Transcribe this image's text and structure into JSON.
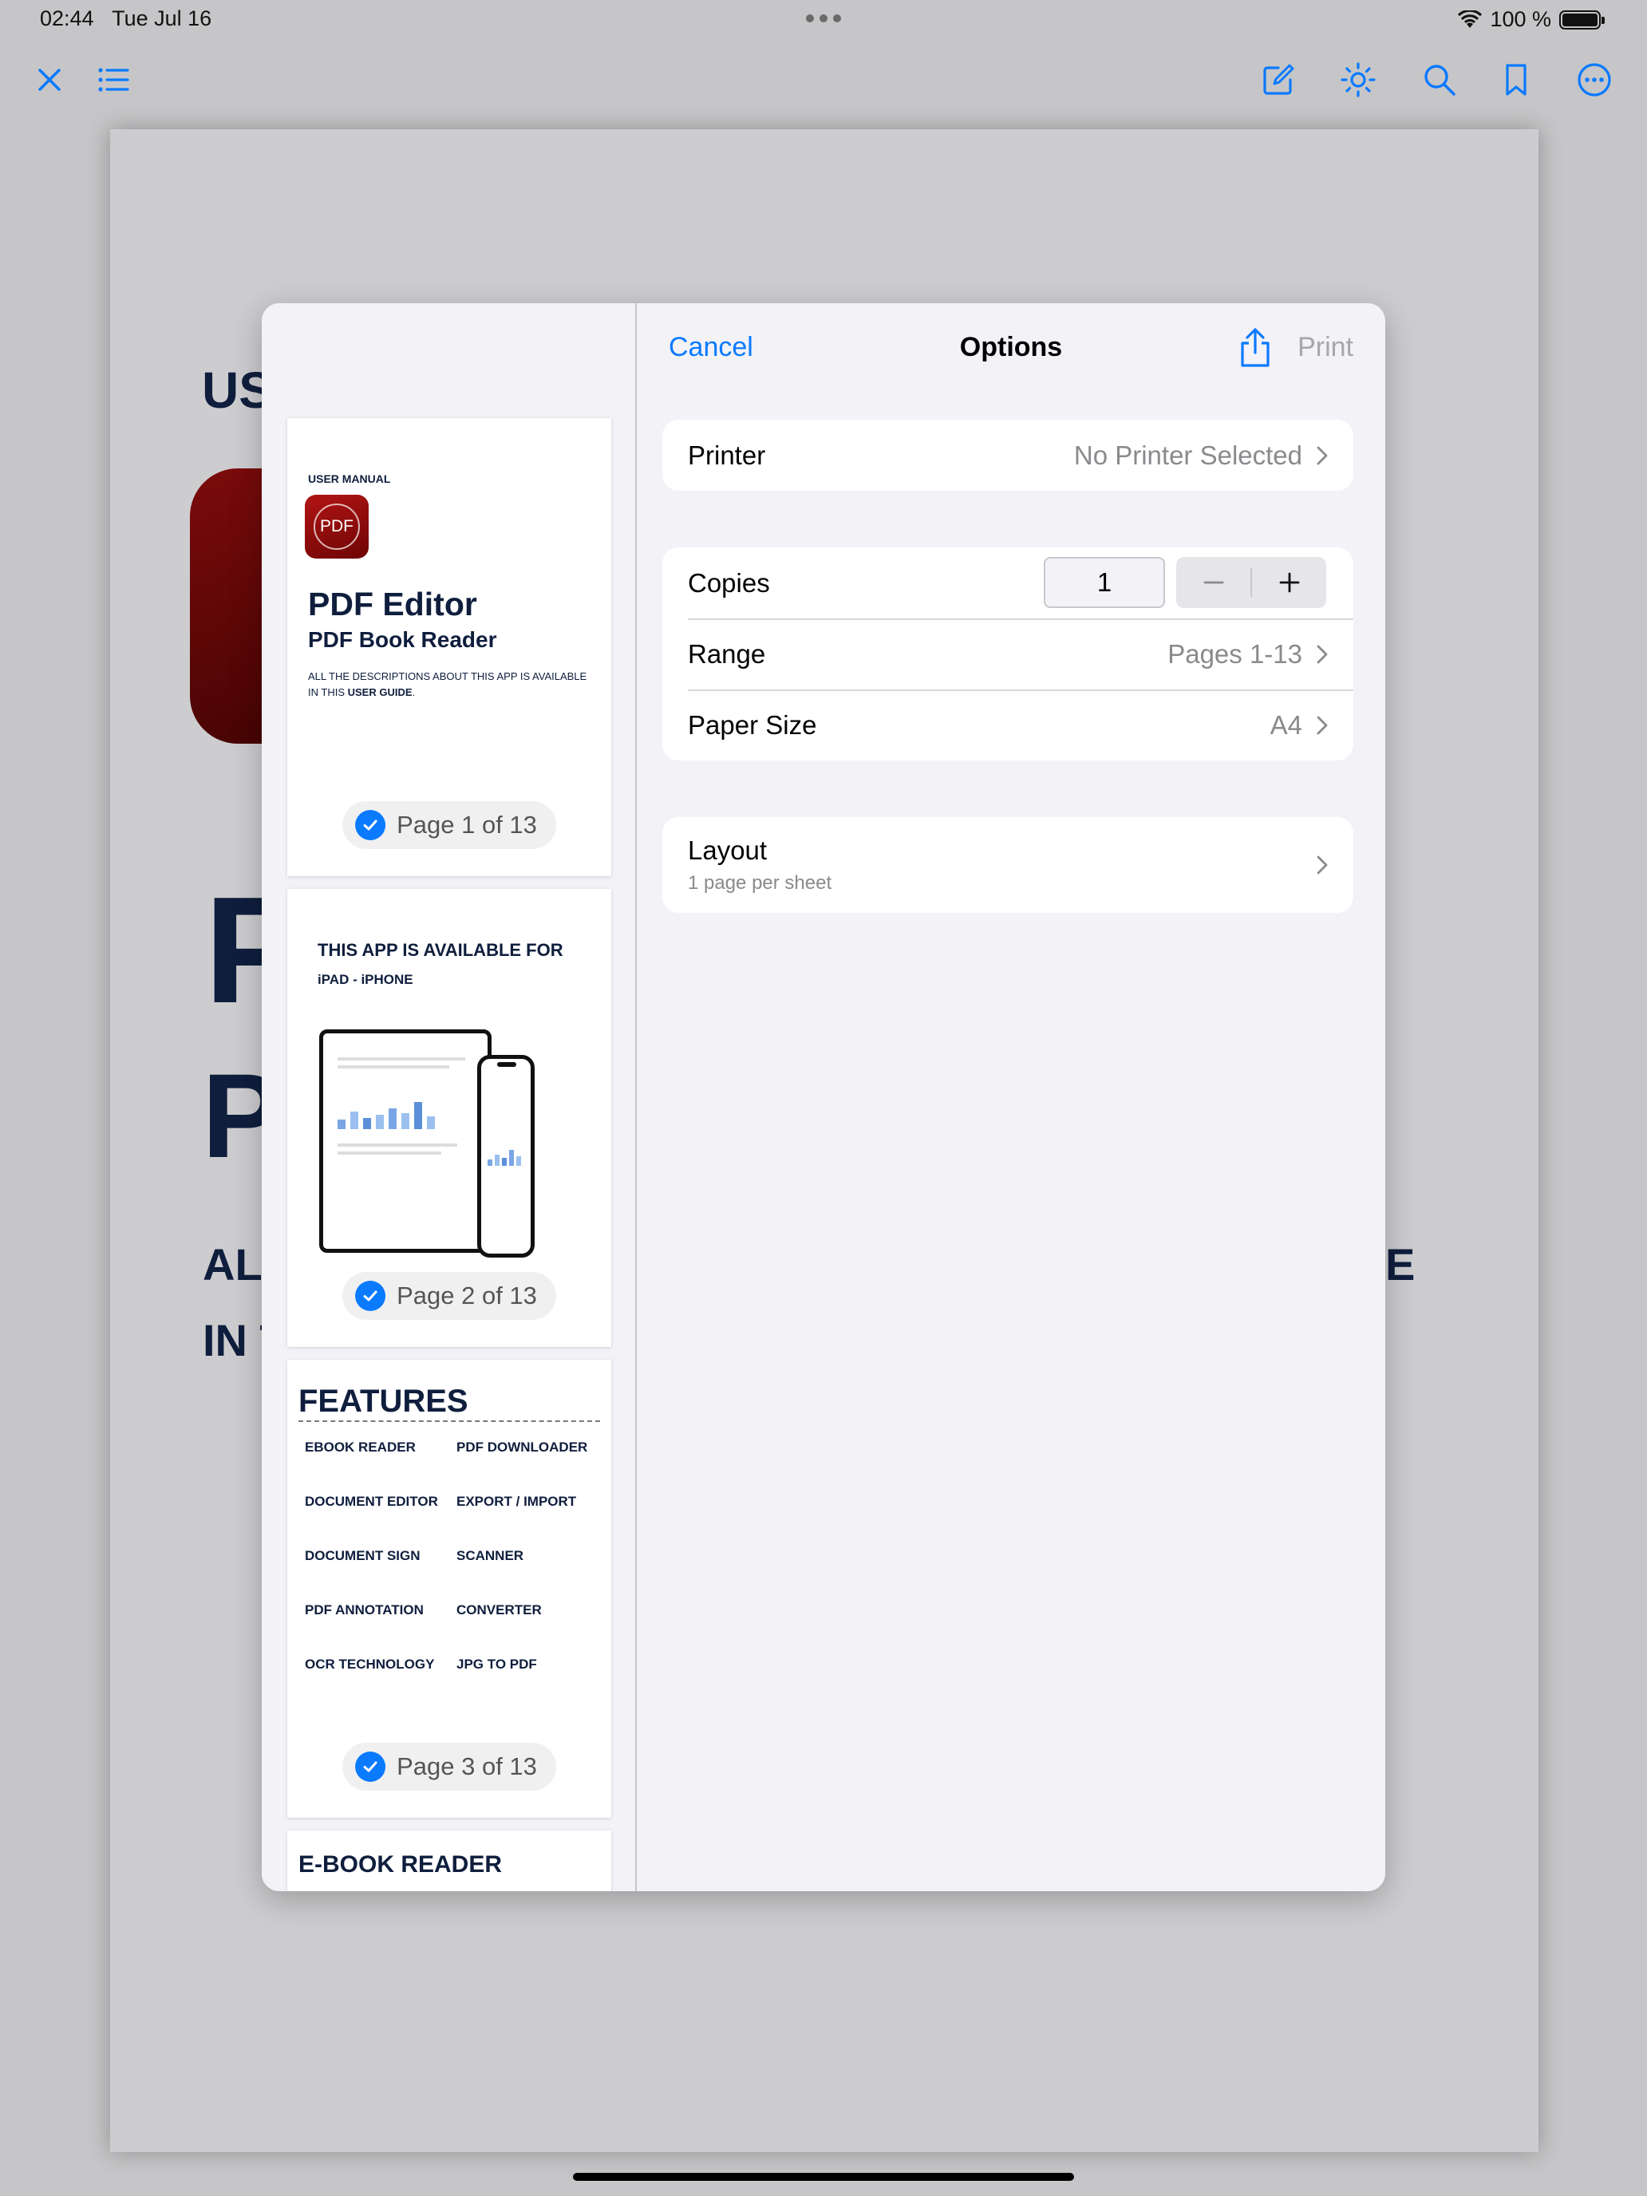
{
  "status_bar": {
    "time": "02:44",
    "date": "Tue Jul 16",
    "battery": "100 %"
  },
  "toolbar": {
    "icons": [
      "close-icon",
      "list-icon",
      "compose-icon",
      "brightness-icon",
      "search-icon",
      "bookmark-icon",
      "more-icon"
    ],
    "accent": "#0a7aff"
  },
  "background_doc": {
    "us_text": "US",
    "p_big_1": "P",
    "p_big_2": "P",
    "al_text": "AL",
    "in_text": "IN T",
    "e_text": "E"
  },
  "thumbnails": {
    "page1": {
      "label_top": "USER MANUAL",
      "logo_text": "PDF",
      "title": "PDF Editor",
      "subtitle": "PDF Book Reader",
      "desc_line1": "ALL THE DESCRIPTIONS ABOUT THIS APP IS AVAILABLE",
      "desc_line2_prefix": "IN THIS ",
      "desc_line2_bold": "USER GUIDE",
      "desc_line2_suffix": ".",
      "pill": "Page 1 of 13"
    },
    "page2": {
      "title": "THIS APP IS AVAILABLE FOR",
      "subtitle": "iPAD - iPHONE",
      "pill": "Page 2 of 13"
    },
    "page3": {
      "title": "FEATURES",
      "features": [
        "EBOOK READER",
        "PDF DOWNLOADER",
        "DOCUMENT EDITOR",
        "EXPORT / IMPORT",
        "DOCUMENT SIGN",
        "SCANNER",
        "PDF ANNOTATION",
        "CONVERTER",
        "OCR TECHNOLOGY",
        "JPG TO PDF"
      ],
      "pill": "Page 3 of 13"
    },
    "page4": {
      "title": "E-BOOK READER"
    }
  },
  "options": {
    "cancel": "Cancel",
    "title": "Options",
    "print": "Print",
    "printer_label": "Printer",
    "printer_value": "No Printer Selected",
    "copies_label": "Copies",
    "copies_value": "1",
    "range_label": "Range",
    "range_value": "Pages 1-13",
    "paper_label": "Paper Size",
    "paper_value": "A4",
    "layout_label": "Layout",
    "layout_sub": "1 page per sheet"
  }
}
